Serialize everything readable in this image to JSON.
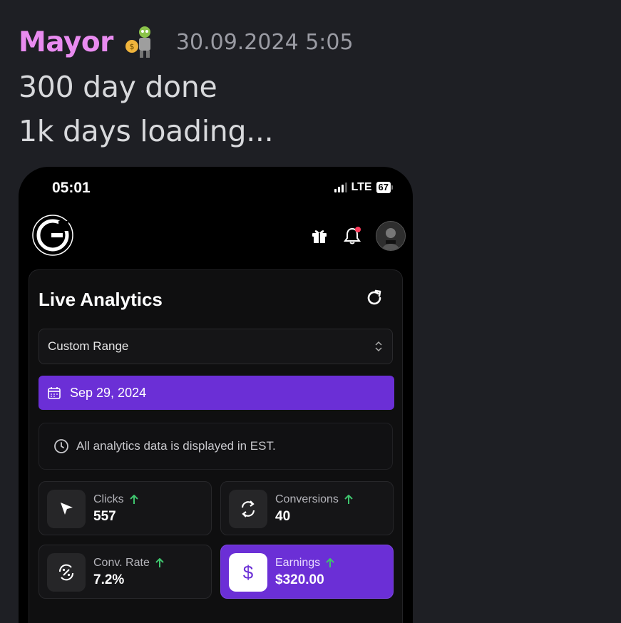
{
  "message": {
    "author": "Mayor",
    "author_emoji": "money-bag-figure-emoji",
    "timestamp": "30.09.2024 5:05",
    "lines": [
      "300 day done",
      "1k days loading..."
    ]
  },
  "phone": {
    "status_bar": {
      "time": "05:01",
      "network": "LTE",
      "battery": "67"
    },
    "header_icons": [
      "gift-icon",
      "bell-icon",
      "avatar"
    ],
    "analytics": {
      "title": "Live Analytics",
      "range_select": "Custom Range",
      "date": "Sep 29, 2024",
      "timezone_note": "All analytics data is displayed in EST.",
      "stats": [
        {
          "label": "Clicks",
          "value": "557",
          "icon": "cursor-icon"
        },
        {
          "label": "Conversions",
          "value": "40",
          "icon": "sync-icon"
        },
        {
          "label": "Conv. Rate",
          "value": "7.2%",
          "icon": "percent-cycle-icon"
        },
        {
          "label": "Earnings",
          "value": "$320.00",
          "icon": "dollar-icon"
        }
      ]
    }
  },
  "colors": {
    "accent": "#6b2fd6",
    "author": "#e98bf0",
    "up_arrow": "#3ec46d",
    "notification": "#ff3b5c"
  }
}
